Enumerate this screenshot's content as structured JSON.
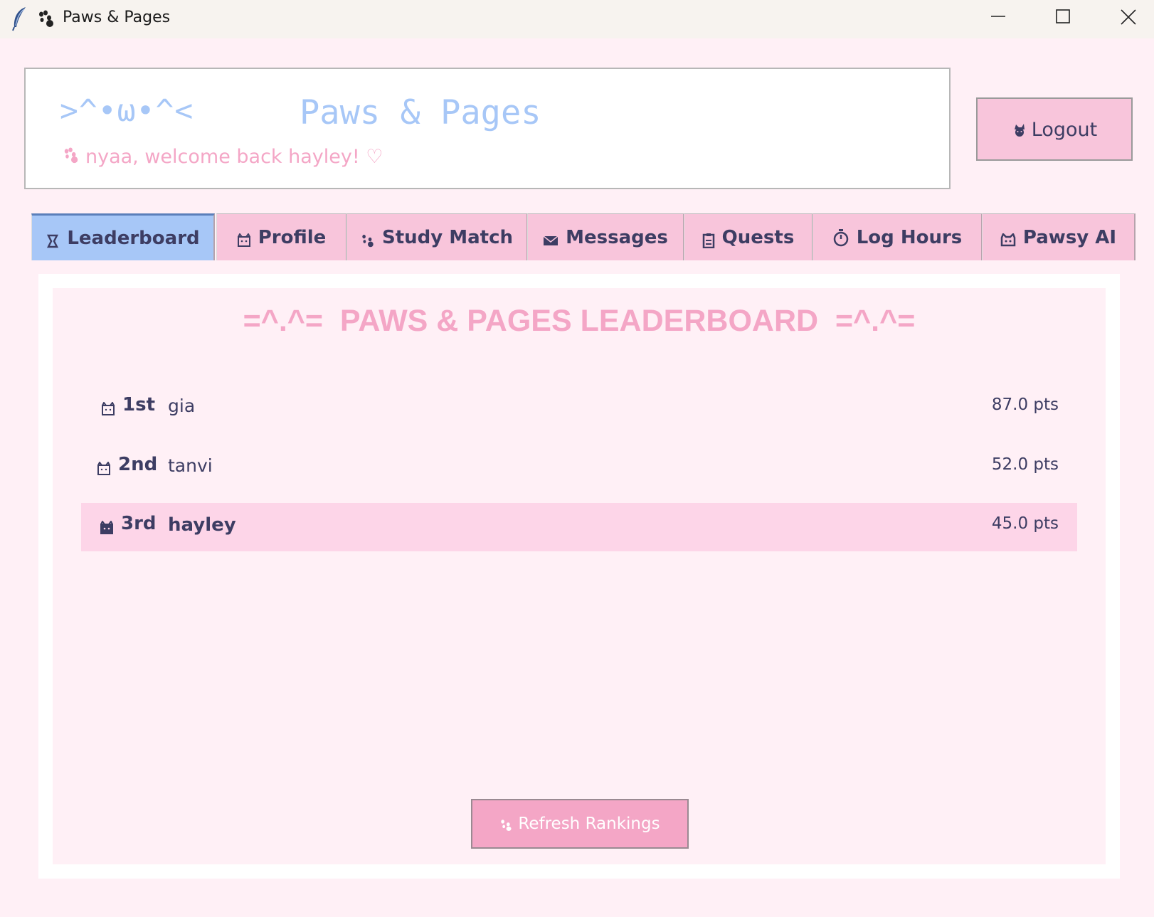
{
  "window": {
    "title": "Paws & Pages"
  },
  "header": {
    "kaomoji": ">^•ω•^<",
    "app_name": "Paws & Pages",
    "welcome": "nyaa, welcome back hayley! ♡",
    "logout_label": "Logout"
  },
  "tabs": [
    {
      "label": "Leaderboard",
      "icon": "trophy-icon",
      "active": true
    },
    {
      "label": "Profile",
      "icon": "cat-face-icon",
      "active": false
    },
    {
      "label": "Study Match",
      "icon": "paw-icon",
      "active": false
    },
    {
      "label": "Messages",
      "icon": "envelope-icon",
      "active": false
    },
    {
      "label": "Quests",
      "icon": "clipboard-icon",
      "active": false
    },
    {
      "label": "Log Hours",
      "icon": "stopwatch-icon",
      "active": false
    },
    {
      "label": "Pawsy AI",
      "icon": "robot-cat-icon",
      "active": false
    }
  ],
  "leaderboard": {
    "title": "=^.^=  PAWS & PAGES LEADERBOARD  =^.^=",
    "rows": [
      {
        "rank": "1st",
        "name": "gia",
        "points": "87.0 pts",
        "icon": "cat-medal-icon",
        "highlight": false
      },
      {
        "rank": "2nd",
        "name": "tanvi",
        "points": "52.0 pts",
        "icon": "cat-medal-icon",
        "highlight": false
      },
      {
        "rank": "3rd",
        "name": "hayley",
        "points": "45.0 pts",
        "icon": "cat-medal-icon",
        "highlight": true
      }
    ],
    "refresh_label": "Refresh Rankings"
  },
  "colors": {
    "background": "#fff0f6",
    "pink": "#f8c5db",
    "pink_accent": "#f4a6c6",
    "blue": "#a7c7f7",
    "text": "#3d3d63",
    "highlight_row": "#fdd5e8"
  }
}
